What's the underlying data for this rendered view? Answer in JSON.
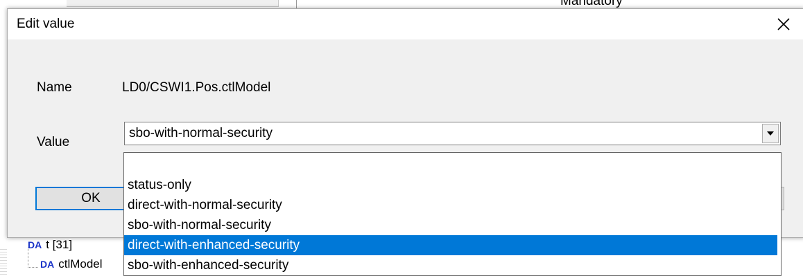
{
  "background": {
    "header_fragment": "Mandatory",
    "tree_items": [
      {
        "tag": "DA",
        "label": "t [31]"
      },
      {
        "tag": "DA",
        "label": "ctlModel"
      }
    ]
  },
  "dialog": {
    "title": "Edit value",
    "close_icon": "close-icon",
    "name_label": "Name",
    "name_value": "LD0/CSWI1.Pos.ctlModel",
    "value_label": "Value",
    "selected_value": "sbo-with-normal-security",
    "ok_label": "OK"
  },
  "dropdown": {
    "options": [
      "",
      "status-only",
      "direct-with-normal-security",
      "sbo-with-normal-security",
      "direct-with-enhanced-security",
      "sbo-with-enhanced-security"
    ],
    "highlighted_index": 4
  },
  "colors": {
    "highlight": "#0078d7",
    "tree_tag": "#1a33c8"
  }
}
